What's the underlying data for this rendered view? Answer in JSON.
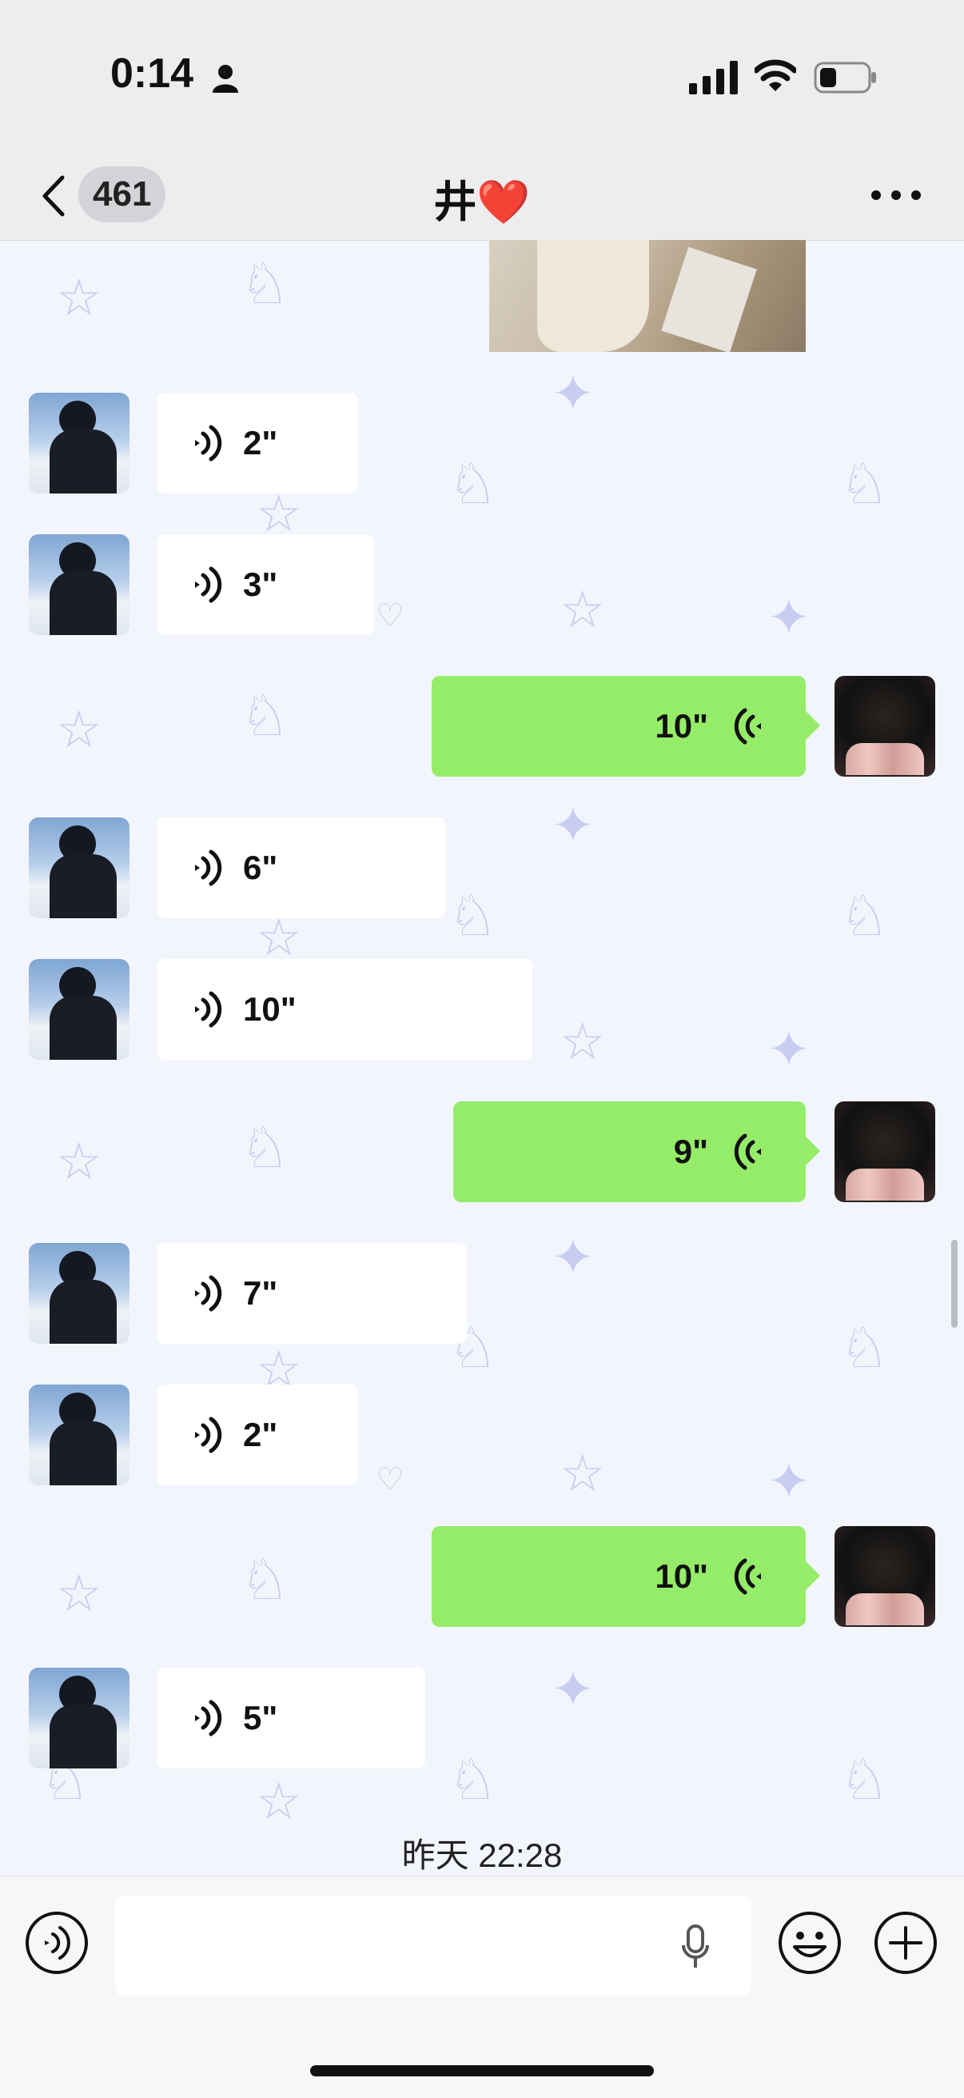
{
  "status_bar": {
    "time": "0:14",
    "icons": [
      "person-icon",
      "signal-icon",
      "wifi-icon",
      "battery-icon"
    ]
  },
  "nav": {
    "back_count": "461",
    "title": "井❤️",
    "more_icon": "more-icon"
  },
  "messages": [
    {
      "type": "image",
      "direction": "out"
    },
    {
      "type": "voice",
      "direction": "in",
      "duration": "2\""
    },
    {
      "type": "voice",
      "direction": "in",
      "duration": "3\""
    },
    {
      "type": "voice",
      "direction": "out",
      "duration": "10\""
    },
    {
      "type": "voice",
      "direction": "in",
      "duration": "6\""
    },
    {
      "type": "voice",
      "direction": "in",
      "duration": "10\""
    },
    {
      "type": "voice",
      "direction": "out",
      "duration": "9\""
    },
    {
      "type": "voice",
      "direction": "in",
      "duration": "7\""
    },
    {
      "type": "voice",
      "direction": "in",
      "duration": "2\""
    },
    {
      "type": "voice",
      "direction": "out",
      "duration": "10\""
    },
    {
      "type": "voice",
      "direction": "in",
      "duration": "5\""
    }
  ],
  "timestamp": "昨天 22:28",
  "input_bar": {
    "placeholder": "",
    "icons": [
      "voice-toggle-icon",
      "mic-icon",
      "emoji-icon",
      "plus-icon"
    ]
  },
  "colors": {
    "outgoing_bubble": "#95ec69",
    "incoming_bubble": "#ffffff",
    "wallpaper": "#f3f5fd",
    "bar_background": "#ededf0"
  }
}
